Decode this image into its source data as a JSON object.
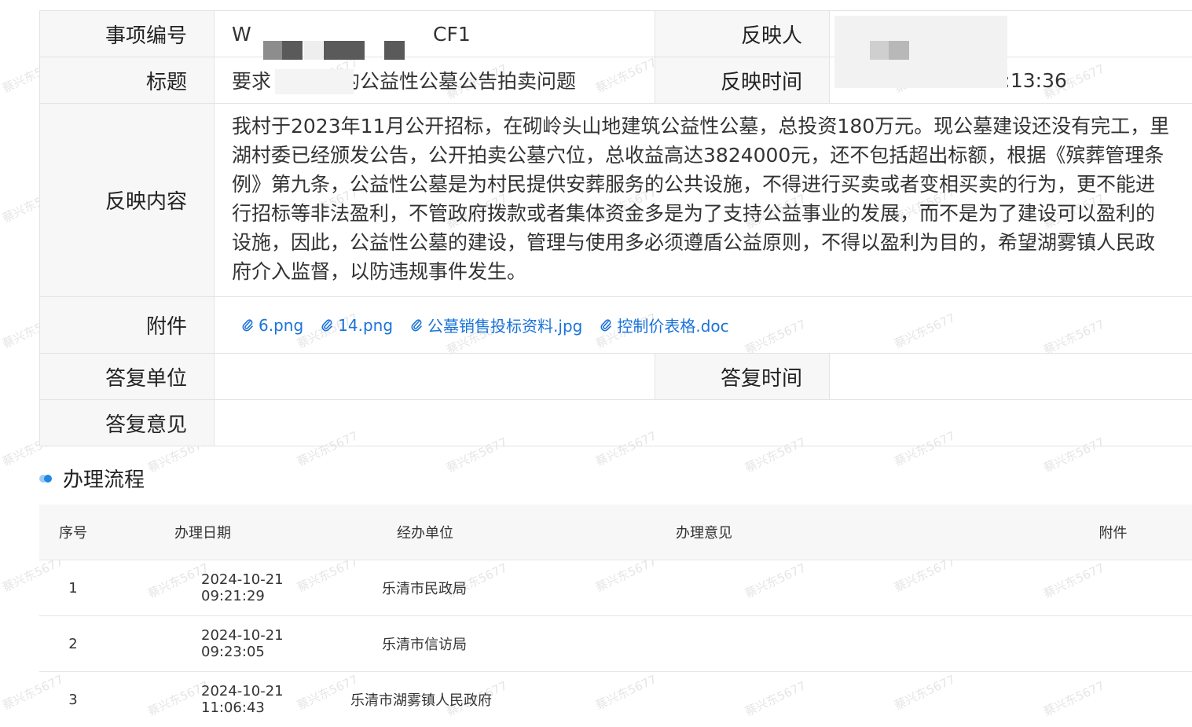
{
  "labels": {
    "event_no": "事项编号",
    "reporter": "反映人",
    "title": "标题",
    "report_time": "反映时间",
    "content": "反映内容",
    "attachments": "附件",
    "reply_unit": "答复单位",
    "reply_time": "答复时间",
    "reply_opinion": "答复意见"
  },
  "detail": {
    "event_no_visible_start": "W",
    "event_no_visible_end": "CF1",
    "title_visible_start": "要求",
    "title_visible_end": "的公益性公墓公告拍卖问题",
    "report_time_visible": "-10-21 08:13:36",
    "content": "我村于2023年11月公开招标，在砌岭头山地建筑公益性公墓，总投资180万元。现公墓建设还没有完工，里湖村委已经颁发公告，公开拍卖公墓穴位，总收益高达3824000元，还不包括超出标额，根据《殡葬管理条例》第九条，公益性公墓是为村民提供安葬服务的公共设施，不得进行买卖或者变相买卖的行为，更不能进行招标等非法盈利，不管政府拨款或者集体资金多是为了支持公益事业的发展，而不是为了建设可以盈利的设施，因此，公益性公墓的建设，管理与使用多必须遵盾公益原则，不得以盈利为目的，希望湖雾镇人民政府介入监督，以防违规事件发生。",
    "attachments": [
      {
        "name": "6.png"
      },
      {
        "name": "14.png"
      },
      {
        "name": "公墓销售投标资料.jpg"
      },
      {
        "name": "控制价表格.doc"
      }
    ]
  },
  "process": {
    "title": "办理流程",
    "columns": [
      "序号",
      "办理日期",
      "经办单位",
      "办理意见",
      "附件"
    ],
    "rows": [
      {
        "no": "1",
        "date": "2024-10-21 09:21:29",
        "unit": "乐清市民政局",
        "opinion": "",
        "attachment": ""
      },
      {
        "no": "2",
        "date": "2024-10-21 09:23:05",
        "unit": "乐清市信访局",
        "opinion": "",
        "attachment": ""
      },
      {
        "no": "3",
        "date": "2024-10-21 11:06:43",
        "unit": "乐清市湖雾镇人民政府",
        "opinion": "",
        "attachment": ""
      }
    ]
  },
  "watermark": "蔡兴东5677",
  "colors": {
    "link": "#1a73d9",
    "accent_dot": "#1e88e5",
    "label_bg": "#f7f7f7"
  },
  "icons": {
    "attachment": "paperclip-icon"
  }
}
